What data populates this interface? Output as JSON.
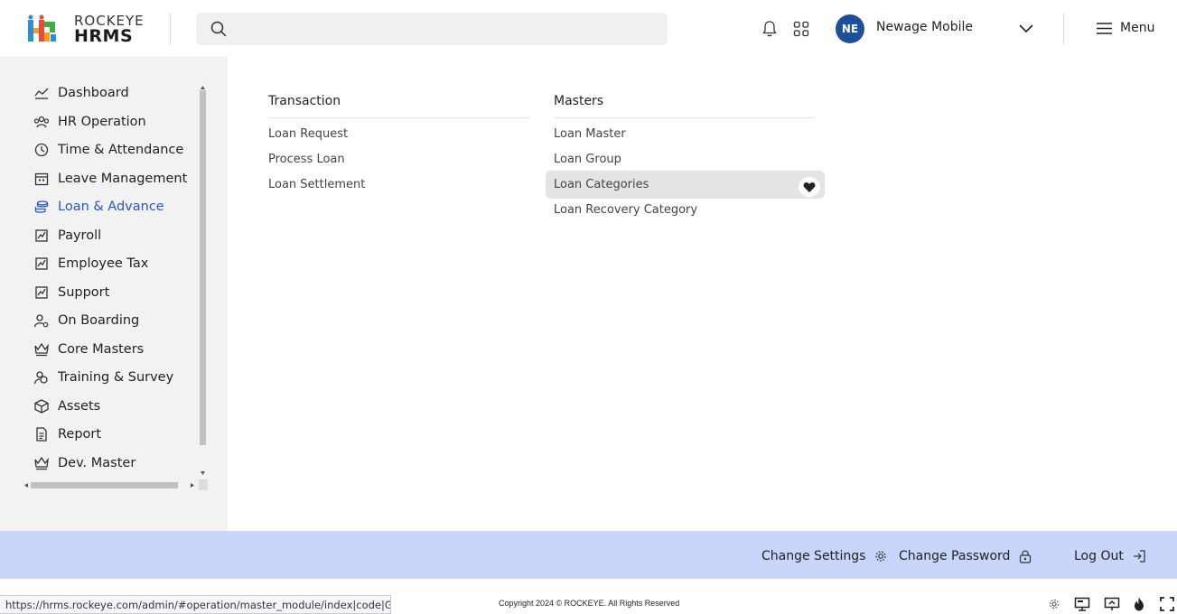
{
  "header": {
    "logo_top": "ROCKEYE",
    "logo_bottom": "HRMS",
    "search_placeholder": "",
    "avatar_initials": "NE",
    "user_name": "Newage Mobile",
    "menu_label": "Menu",
    "colors": {
      "avatar_bg": "#1e4f9c",
      "search_bg": "#f0f0f0"
    }
  },
  "sidebar": {
    "items": [
      {
        "label": "Dashboard",
        "icon": "dashboard-icon"
      },
      {
        "label": "HR Operation",
        "icon": "hr-operation-icon"
      },
      {
        "label": "Time & Attendance",
        "icon": "clock-history-icon"
      },
      {
        "label": "Leave Management",
        "icon": "calendar-icon"
      },
      {
        "label": "Loan & Advance",
        "icon": "coins-icon",
        "active": true
      },
      {
        "label": "Payroll",
        "icon": "chart-icon"
      },
      {
        "label": "Employee Tax",
        "icon": "chart-icon"
      },
      {
        "label": "Support",
        "icon": "chart-icon"
      },
      {
        "label": "On Boarding",
        "icon": "user-gear-icon"
      },
      {
        "label": "Core Masters",
        "icon": "crown-icon"
      },
      {
        "label": "Training & Survey",
        "icon": "users-icon"
      },
      {
        "label": "Assets",
        "icon": "box-icon"
      },
      {
        "label": "Report",
        "icon": "document-icon"
      },
      {
        "label": "Dev. Master",
        "icon": "crown-icon"
      }
    ],
    "active_color": "#2756c9"
  },
  "content": {
    "transaction": {
      "heading": "Transaction",
      "links": [
        "Loan Request",
        "Process Loan",
        "Loan Settlement"
      ]
    },
    "masters": {
      "heading": "Masters",
      "links": [
        "Loan Master",
        "Loan Group",
        "Loan Categories",
        "Loan Recovery Category"
      ],
      "highlighted": "Loan Categories"
    }
  },
  "footer": {
    "change_settings": "Change Settings",
    "change_password": "Change Password",
    "log_out": "Log Out",
    "bar_color": "#c9d5fb"
  },
  "statusbar": {
    "url": "https://hrms.rockeye.com/admin/#operation/master_module/index|code|GEN...",
    "copyright": "Copyright 2024 © ROCKEYE. All Rights Reserved"
  }
}
